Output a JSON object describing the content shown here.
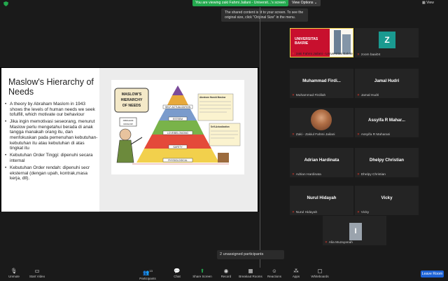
{
  "top": {
    "share_text": "You are viewing zaki Fahmi Jailani - Universit...'s screen",
    "view_options": "View Options ⌄",
    "view_button": "View",
    "tooltip": "The shared content is fit to your screen. To see the original size, click \"Original Size\" in the menu."
  },
  "slide": {
    "title": "Maslow's Hierarchy of Needs",
    "bullets": [
      "A theory by Abraham Maslom in 1943 shows the levels of human needs we seek tofulfill, which motivate our behaviour",
      "Jika ingin memotivasi seseorang, menurut Maslow perlu mengetahui berada di anak tangga manakah orang itu, dan menfokuskan pada pemenuhan kebutuhan-kebutuhan itu atau kebutuhan di atas tingkat itu",
      "Kebutuhan Order Tinggi: dipenuhi secara internal",
      "Kebutuhan Order rendah: dipenuhi secr eksternal (dengan upah, kontrak,masa kerja, dll)."
    ],
    "pyramid": {
      "title": "MASLOW'S HIERARCHY OF NEEDS",
      "name_tag": "ABRAHAM MASLOW",
      "levels": [
        "SELF-ACTUALIZATION",
        "ESTEEM",
        "LOVE/BELONGING",
        "SAFETY",
        "PHYSIOLOGICAL"
      ],
      "note1_title": "Abraham Harold Maslow",
      "note2_title": "Self-Actualization"
    }
  },
  "participants": [
    {
      "name": "zaki Fahmi Jailani - Universitas Bakrie",
      "type": "camera"
    },
    {
      "name": "zoom baai04",
      "type": "avatar",
      "initial": "Z",
      "avatar_color": "#1a9a90"
    },
    {
      "name": "Muhammad Firdilah",
      "display": "Muhammad Firdi...",
      "type": "name"
    },
    {
      "name": "Jamal Hudri",
      "display": "Jamal Hudri",
      "type": "name"
    },
    {
      "name": "Zaki - Zakiul Fahmi Jailani",
      "type": "photo"
    },
    {
      "name": "Assyifa R Maharani",
      "display": "Assyifa R Mahar...",
      "type": "name"
    },
    {
      "name": "Adrian Hardinata",
      "display": "Adrian Hardinata",
      "type": "name"
    },
    {
      "name": "Dhelpy Christian",
      "display": "Dhelpy Christian",
      "type": "name"
    },
    {
      "name": "Nurul Hidayah",
      "display": "Nurul Hidayah",
      "type": "name"
    },
    {
      "name": "Vicky",
      "display": "Vicky",
      "type": "name"
    },
    {
      "name": "Alia Muzayanah",
      "type": "avatar",
      "initial": "I",
      "avatar_color": "#9aa3ad"
    }
  ],
  "camera_tile": {
    "brand_line1": "UNIVERSITAS",
    "brand_line2": "BAKRIE"
  },
  "unassigned": "2 unassigned participants",
  "toolbar": {
    "unmute": "Unmute",
    "start_video": "Start Video",
    "participants": "Participants",
    "participants_count": "13",
    "chat": "Chat",
    "share_screen": "Share Screen",
    "record": "Record",
    "breakout_rooms": "Breakout Rooms",
    "reactions": "Reactions",
    "apps": "Apps",
    "whiteboards": "Whiteboards",
    "leave": "Leave Room"
  },
  "colors": {
    "share_green": "#23a94e",
    "leave_blue": "#1e63d6",
    "avatar_teal": "#1a9a90",
    "muted_red": "#e0392b"
  }
}
